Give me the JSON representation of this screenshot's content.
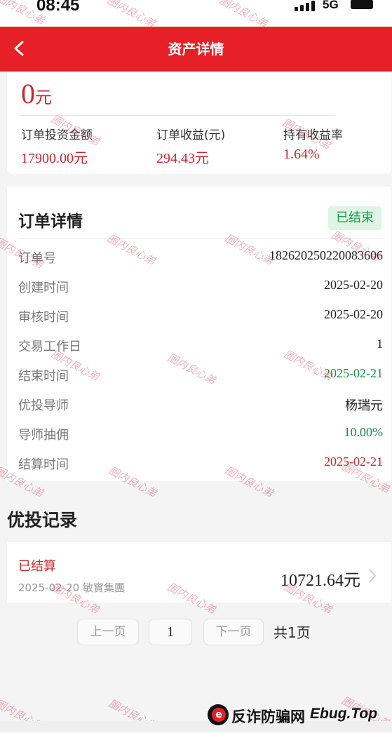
{
  "status_bar": {
    "time": "08:45",
    "network": "5G"
  },
  "header": {
    "title": "资产详情"
  },
  "summary": {
    "amount_num": "0",
    "amount_unit": "元",
    "stats": [
      {
        "label": "订单投资金额",
        "value": "17900.00元"
      },
      {
        "label": "订单收益(元)",
        "value": "294.43元"
      },
      {
        "label": "持有收益率",
        "value": "1.64%"
      }
    ]
  },
  "order": {
    "title": "订单详情",
    "status": "已结束",
    "rows": [
      {
        "key": "订单号",
        "value": "1826202502200836​06"
      },
      {
        "key": "创建时间",
        "value": "2025-02-20"
      },
      {
        "key": "审核时间",
        "value": "2025-02-20"
      },
      {
        "key": "交易工作日",
        "value": "1"
      },
      {
        "key": "结束时间",
        "value": "2025-02-21"
      },
      {
        "key": "优投导师",
        "value": "杨瑞元"
      },
      {
        "key": "导师抽佣",
        "value": "10.00%"
      },
      {
        "key": "结算时间",
        "value": "2025-02-21"
      }
    ]
  },
  "records": {
    "title": "优投记录",
    "items": [
      {
        "status": "已结算",
        "meta": "2025-02-20  敏實集團",
        "amount": "10721.64元"
      }
    ]
  },
  "pager": {
    "prev": "上一页",
    "page": "1",
    "next": "下一页",
    "total": "共1页"
  },
  "watermark": "圈内良心弟",
  "footer": {
    "brand": "反诈防骗网",
    "domain": "Ebug.Top"
  },
  "colors": {
    "brand_red": "#e62026",
    "value_red": "#c8282e",
    "green": "#1a8a46",
    "tag_bg": "#dff5e4"
  }
}
